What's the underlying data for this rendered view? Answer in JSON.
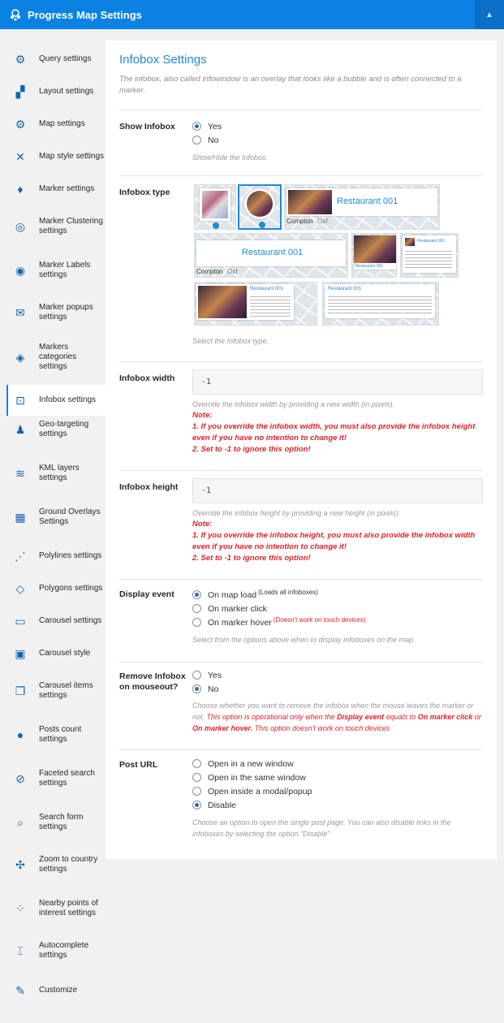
{
  "app": {
    "title": "Progress Map Settings",
    "collapse_icon": "chevron-up-icon"
  },
  "sidebar": {
    "items": [
      {
        "label": "Query settings",
        "icon": "gear-icon"
      },
      {
        "label": "Layout settings",
        "icon": "layout-icon"
      },
      {
        "label": "Map settings",
        "icon": "gear-icon"
      },
      {
        "label": "Map style settings",
        "icon": "brush-icon"
      },
      {
        "label": "Marker settings",
        "icon": "marker-icon"
      },
      {
        "label": "Marker Clustering settings",
        "icon": "cluster-icon"
      },
      {
        "label": "Marker Labels settings",
        "icon": "label-icon"
      },
      {
        "label": "Marker popups settings",
        "icon": "popup-icon"
      },
      {
        "label": "Markers categories settings",
        "icon": "categories-icon"
      },
      {
        "label": "Infobox settings",
        "icon": "infobox-icon"
      },
      {
        "label": "Geo-targeting settings",
        "icon": "person-icon"
      },
      {
        "label": "KML layers settings",
        "icon": "layers-icon"
      },
      {
        "label": "Ground Overlays Settings",
        "icon": "overlay-icon"
      },
      {
        "label": "Polylines settings",
        "icon": "polyline-icon"
      },
      {
        "label": "Polygons settings",
        "icon": "polygon-icon"
      },
      {
        "label": "Carousel settings",
        "icon": "carousel-icon"
      },
      {
        "label": "Carousel style",
        "icon": "carousel-style-icon"
      },
      {
        "label": "Carousel items settings",
        "icon": "items-icon"
      },
      {
        "label": "Posts count settings",
        "icon": "pin-icon"
      },
      {
        "label": "Faceted search settings",
        "icon": "filter-icon"
      },
      {
        "label": "Search form settings",
        "icon": "search-icon"
      },
      {
        "label": "Zoom to country settings",
        "icon": "zoom-icon"
      },
      {
        "label": "Nearby points of interest settings",
        "icon": "poi-icon"
      },
      {
        "label": "Autocomplete settings",
        "icon": "autocomplete-icon"
      },
      {
        "label": "Customize",
        "icon": "wrench-icon"
      }
    ],
    "active_index": 9
  },
  "main": {
    "title": "Infobox Settings",
    "description": "The infobox, also called infowindow is an overlay that looks like a bubble and is often connected to a marker.",
    "show_infobox": {
      "label": "Show Infobox",
      "options": [
        "Yes",
        "No"
      ],
      "selected": 0,
      "help": "Show/Hide the Infobox."
    },
    "infobox_type": {
      "label": "Infobox type",
      "help": "Select the Infobox type.",
      "thumb_title": "Restaurant 001",
      "thumb_map_word": "Compton",
      "thumb_map_word2": "Oxf"
    },
    "infobox_width": {
      "label": "Infobox width",
      "value": "-1",
      "help": "Override the infobox width by providing a new width (in pixels).",
      "note_title": "Note:",
      "note_1": "1. If you override the infobox width, you must also provide the infobox height even if you have no intention to change it!",
      "note_2": "2. Set to -1 to ignore this option!"
    },
    "infobox_height": {
      "label": "Infobox height",
      "value": "-1",
      "help": "Override the infobox height by providing a new height (in pixels).",
      "note_title": "Note:",
      "note_1": "1. If you override the infobox height, you must also provide the infobox width even if you have no intention to change it!",
      "note_2": "2. Set to -1 to ignore this option!"
    },
    "display_event": {
      "label": "Display event",
      "options": [
        "On map load",
        "On marker click",
        "On marker hover"
      ],
      "option_notes": [
        "(Loads all infoboxes)",
        "",
        "(Doesn't work on touch devices)"
      ],
      "selected": 0,
      "help": "Select from the options above when to display infoboxes on the map."
    },
    "remove_infobox": {
      "label": "Remove Infobox on mouseout?",
      "options": [
        "Yes",
        "No"
      ],
      "selected": 1,
      "help_1": "Choose whether you want to remove the infobox when the mouse leaves the marker or not.",
      "help_2": "This option is operational only when the",
      "help_3": "Display event",
      "help_4": "equals to",
      "help_5": "On marker click",
      "help_6": "or",
      "help_7": "On marker hover.",
      "help_8": "This option doesn't work on touch devices"
    },
    "post_url": {
      "label": "Post URL",
      "options": [
        "Open in a new window",
        "Open in the same window",
        "Open inside a modal/popup",
        "Disable"
      ],
      "selected": 3,
      "help": "Choose an option to open the single post page. You can also disable links in the infoboxes by selecting the option \"Disable\""
    }
  },
  "colors": {
    "accent": "#0a82e4",
    "title": "#1e8bd2",
    "warning": "#e0212b"
  }
}
